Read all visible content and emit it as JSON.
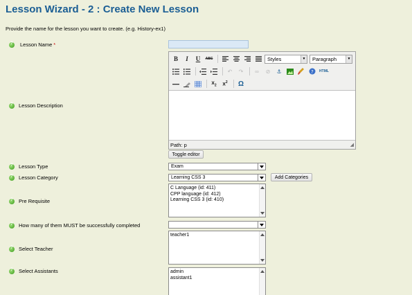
{
  "page": {
    "title": "Lesson Wizard - 2 : Create New Lesson",
    "intro": "Provide the name for the lesson you want to create. (e.g. History-ex1)"
  },
  "form": {
    "lesson_name": {
      "label": "Lesson Name",
      "required_mark": "*",
      "value": ""
    },
    "lesson_description": {
      "label": "Lesson Description"
    },
    "lesson_type": {
      "label": "Lesson Type",
      "value": "Exam"
    },
    "lesson_category": {
      "label": "Lesson Category",
      "value": "Learning CSS 3"
    },
    "add_categories_button": "Add Categories",
    "pre_requisite": {
      "label": "Pre Requisite",
      "options": [
        "C Language (id: 411)",
        "CPP language (id: 412)",
        "Learning CSS 3 (id: 410)"
      ]
    },
    "must_complete": {
      "label": "How many of them MUST be successfully completed",
      "value": ""
    },
    "select_teacher": {
      "label": "Select Teacher",
      "options": [
        "teacher1"
      ]
    },
    "select_assistants": {
      "label": "Select Assistants",
      "options": [
        "admin",
        "assistant1"
      ]
    }
  },
  "editor": {
    "styles_select": "Styles",
    "paragraph_select": "Paragraph",
    "path_text": "Path: p",
    "toggle_button": "Toggle editor",
    "toolbar_row1": [
      {
        "name": "bold-button",
        "glyph": "B",
        "cls": "b"
      },
      {
        "name": "italic-button",
        "glyph": "I",
        "cls": "i"
      },
      {
        "name": "underline-button",
        "glyph": "U",
        "cls": "u"
      },
      {
        "name": "strikethrough-button",
        "glyph": "ABC",
        "cls": "tiny"
      }
    ],
    "toolbar_row2_icons": [
      "bullet-list-icon",
      "numbered-list-icon",
      "outdent-icon",
      "indent-icon",
      "undo-icon",
      "redo-icon",
      "link-icon",
      "unlink-icon",
      "anchor-icon",
      "image-icon",
      "cleanup-icon",
      "help-icon",
      "html-icon"
    ],
    "html_label": "HTML",
    "toolbar_row3_icons": [
      "horizontal-rule-icon",
      "remove-format-icon",
      "table-icon",
      "subscript-icon",
      "superscript-icon",
      "special-char-icon"
    ]
  },
  "colors": {
    "title": "#1b5e94",
    "background": "#eef0dc",
    "required": "#cc0000"
  }
}
